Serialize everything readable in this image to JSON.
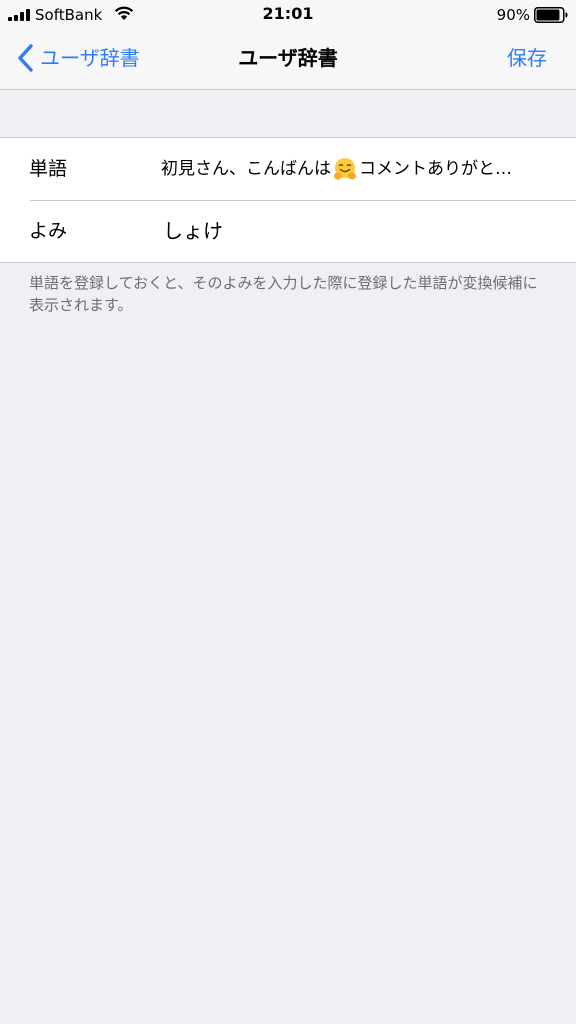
{
  "status_bar": {
    "carrier": "SoftBank",
    "time": "21:01",
    "battery_percent": "90%",
    "battery_level": 0.9
  },
  "nav": {
    "back_label": "ユーザ辞書",
    "title": "ユーザ辞書",
    "save_label": "保存"
  },
  "form": {
    "word": {
      "label": "単語",
      "value_before_emoji": "初見さん、こんばんは",
      "emoji": "smiling-face-with-open-hands",
      "value_after_emoji": "コメントありがと…"
    },
    "reading": {
      "label": "よみ",
      "value": "しょけ"
    }
  },
  "footnote": "単語を登録しておくと、そのよみを入力した際に登録した単語が変換候補に表示されます。",
  "colors": {
    "accent": "#2f7cf6",
    "background": "#efeff4",
    "footnote": "#6d6d72"
  }
}
